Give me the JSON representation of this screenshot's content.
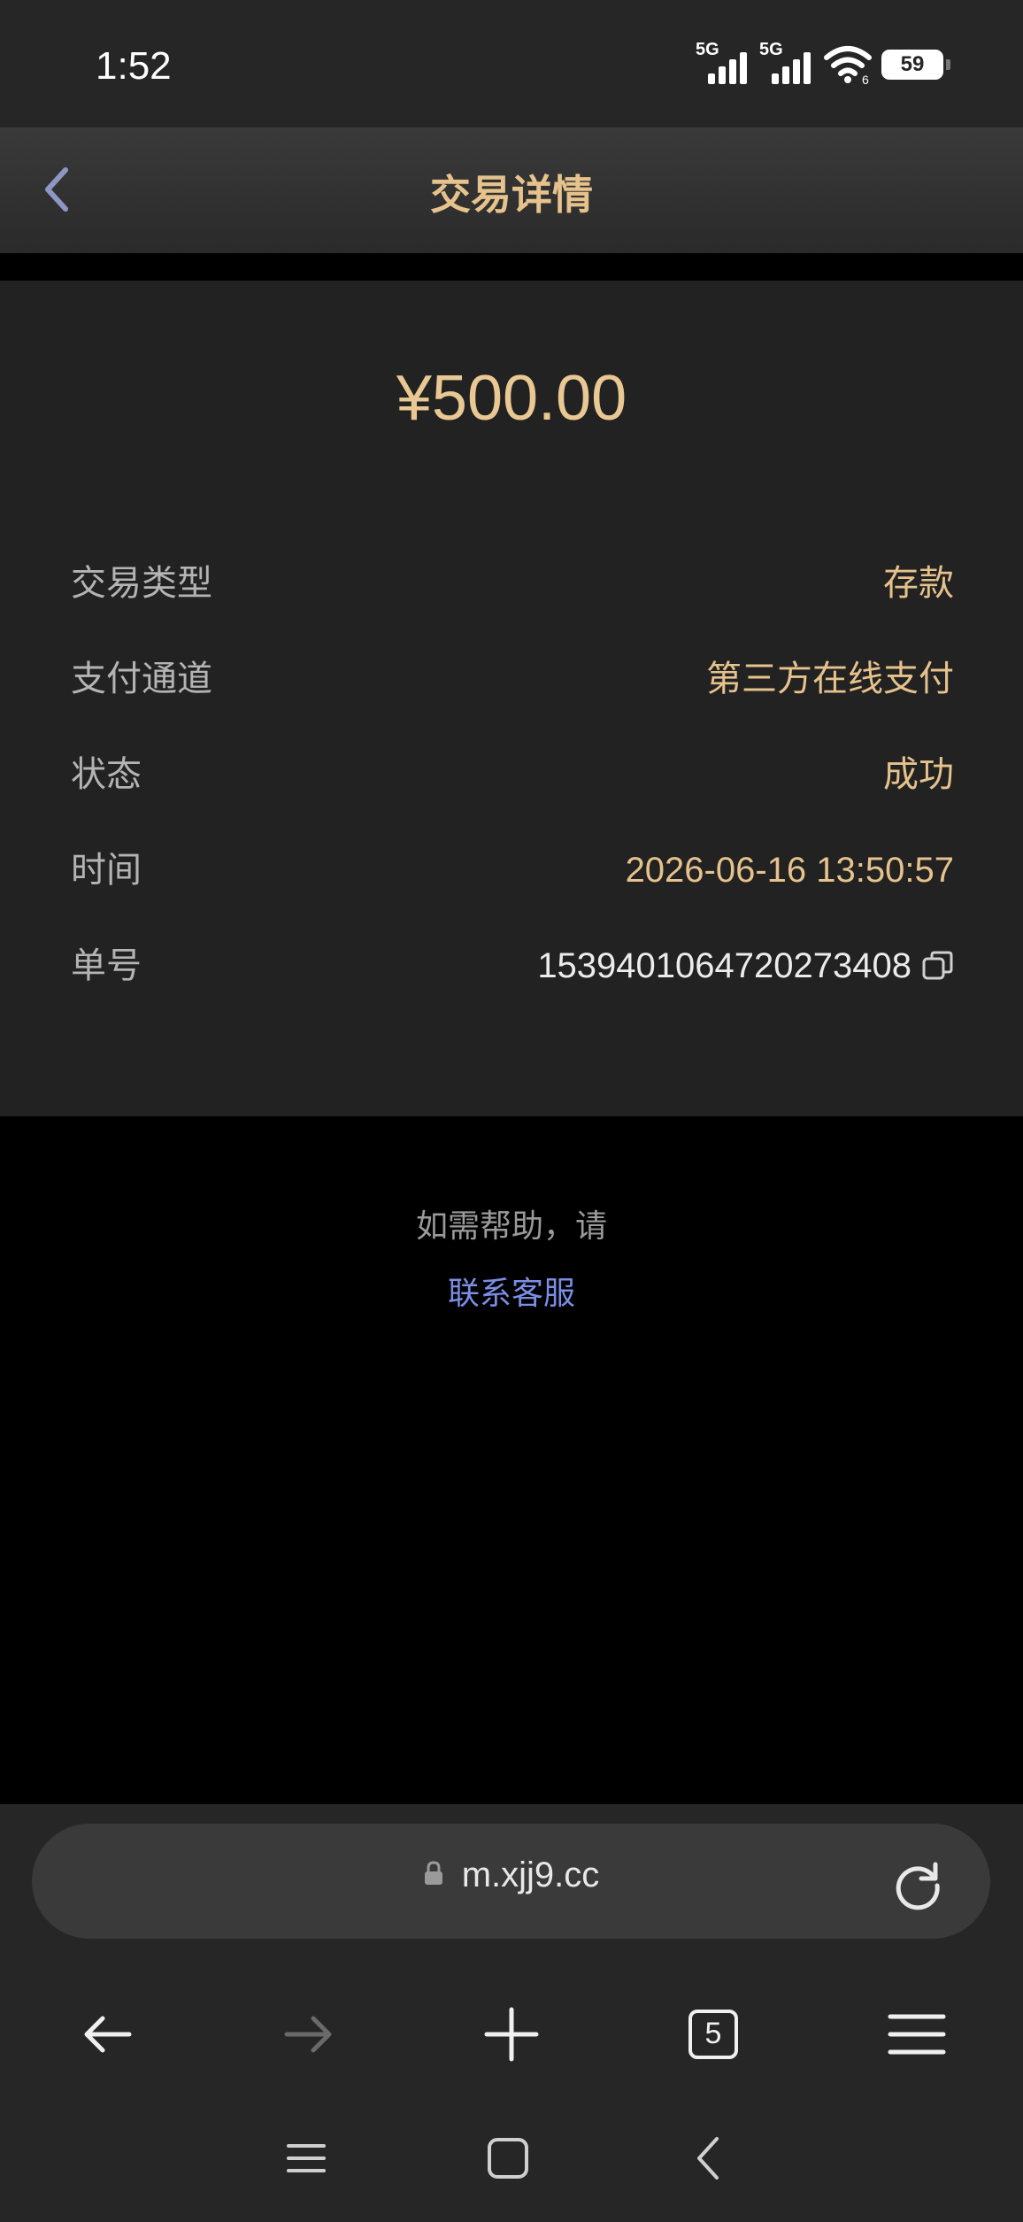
{
  "status_bar": {
    "time": "1:52",
    "signal1_label": "5G",
    "signal2_label": "5G",
    "wifi_icon": "wifi-icon",
    "battery": "59"
  },
  "header": {
    "title": "交易详情",
    "back_icon": "chevron-left-icon"
  },
  "transaction": {
    "amount": "¥500.00",
    "rows": [
      {
        "label": "交易类型",
        "value": "存款"
      },
      {
        "label": "支付通道",
        "value": "第三方在线支付"
      },
      {
        "label": "状态",
        "value": "成功"
      },
      {
        "label": "时间",
        "value": "2026-06-16 13:50:57"
      },
      {
        "label": "单号",
        "value": "1539401064720273408"
      }
    ],
    "copy_icon": "copy-icon"
  },
  "help": {
    "text": "如需帮助，请",
    "link": "联系客服"
  },
  "browser": {
    "url": "m.xjj9.cc",
    "tab_count": "5",
    "icons": [
      "lock-icon",
      "reload-icon",
      "arrow-left-icon",
      "arrow-right-icon",
      "plus-icon",
      "tabs-icon",
      "menu-icon"
    ]
  },
  "system_nav": {
    "icons": [
      "recents-icon",
      "home-icon",
      "back-icon"
    ]
  },
  "colors": {
    "accent_gold": "#e6c28c",
    "link_blue": "#7b8ee6",
    "card_bg": "#222222",
    "page_bg": "#000000"
  }
}
